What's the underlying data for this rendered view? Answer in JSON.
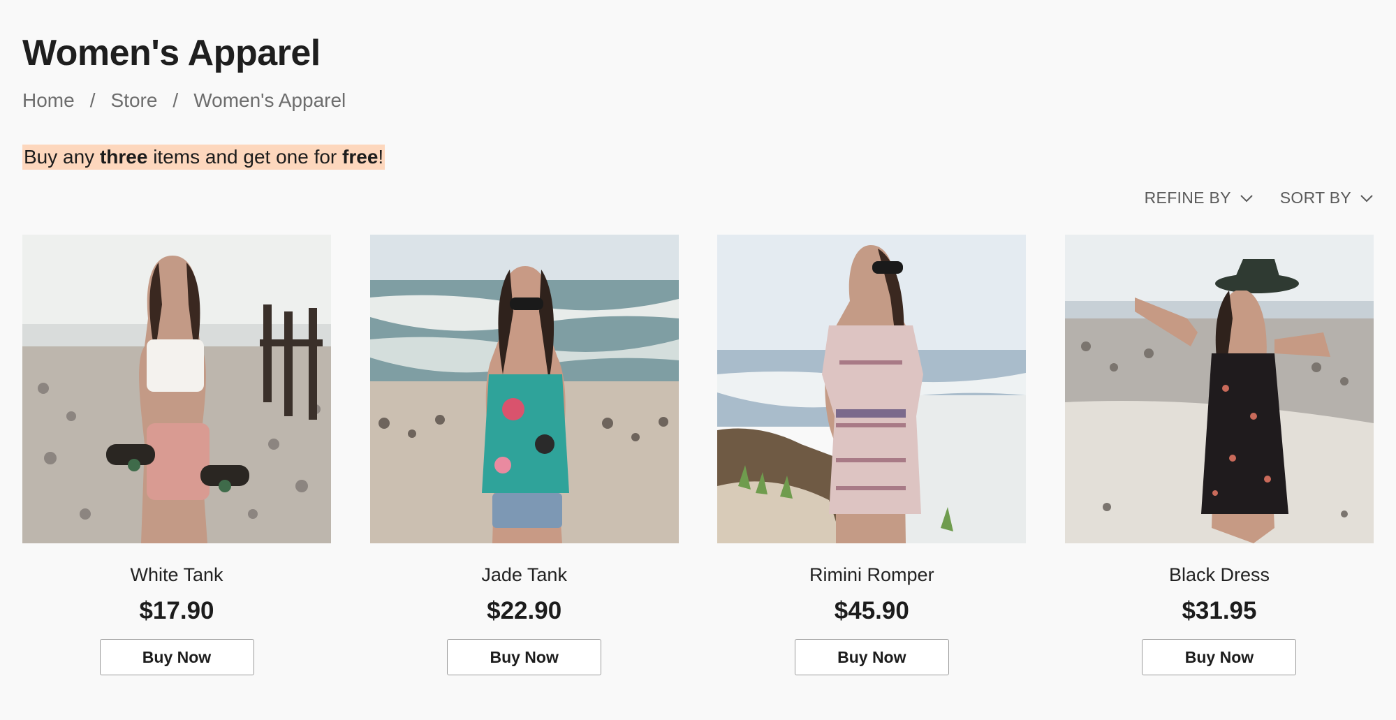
{
  "page": {
    "title": "Women's Apparel"
  },
  "breadcrumb": {
    "items": [
      "Home",
      "Store",
      "Women's Apparel"
    ],
    "separator": "/"
  },
  "promo": {
    "before": "Buy any ",
    "bold1": "three",
    "middle": " items and get one for ",
    "bold2": "free",
    "after": "!",
    "highlight_color": "#fdd7bd"
  },
  "filters": {
    "refine_label": "REFINE BY",
    "sort_label": "SORT BY",
    "icon": "chevron-down-icon"
  },
  "products": [
    {
      "name": "White Tank",
      "price": "$17.90",
      "button": "Buy Now"
    },
    {
      "name": "Jade Tank",
      "price": "$22.90",
      "button": "Buy Now"
    },
    {
      "name": "Rimini Romper",
      "price": "$45.90",
      "button": "Buy Now"
    },
    {
      "name": "Black Dress",
      "price": "$31.95",
      "button": "Buy Now"
    }
  ]
}
